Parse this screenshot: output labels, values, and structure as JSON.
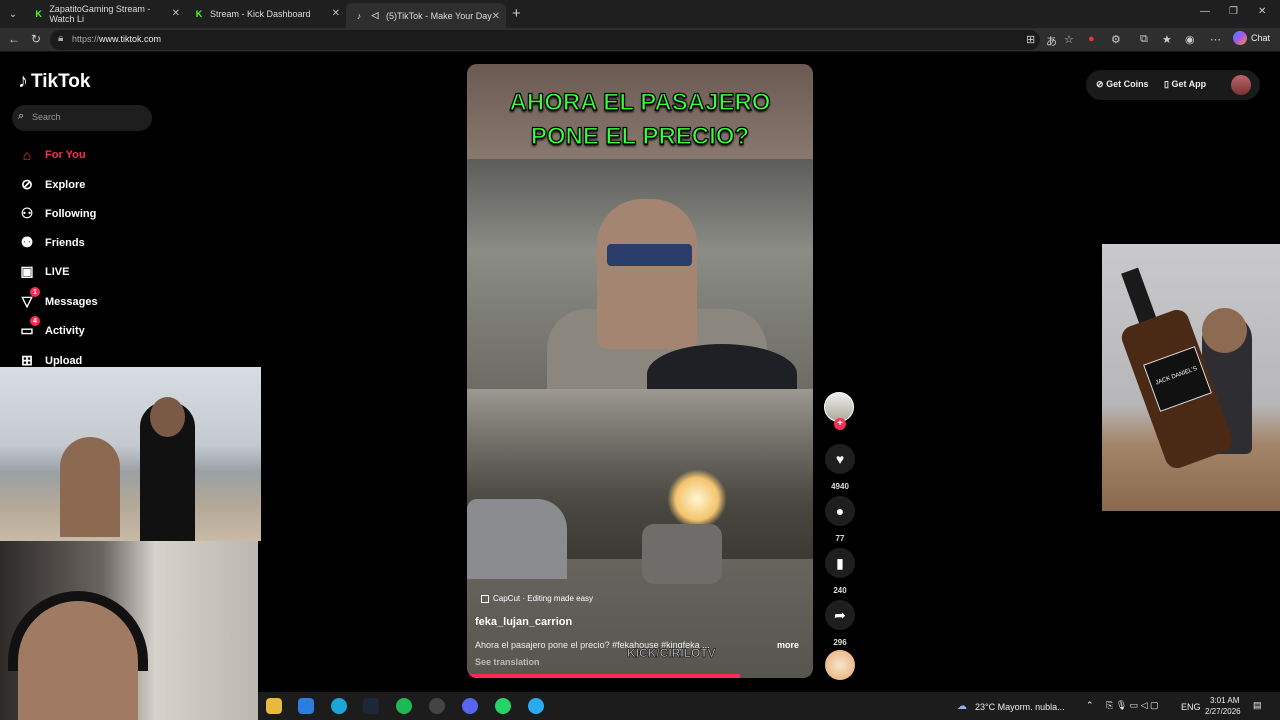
{
  "browser": {
    "tabs": [
      {
        "title": "ZapatitoGaming Stream - Watch Li"
      },
      {
        "title": "Stream - Kick Dashboard"
      },
      {
        "title": "(5)TikTok - Make Your Day",
        "active": true
      }
    ],
    "url_scheme": "https://",
    "url_host": "www.tiktok.com",
    "chat_label": "Chat"
  },
  "tiktok": {
    "logo": "TikTok",
    "search_placeholder": "Search",
    "nav": [
      {
        "label": "For You",
        "icon": "home-icon",
        "active": true
      },
      {
        "label": "Explore",
        "icon": "compass-icon"
      },
      {
        "label": "Following",
        "icon": "following-icon"
      },
      {
        "label": "Friends",
        "icon": "friends-icon"
      },
      {
        "label": "LIVE",
        "icon": "live-icon"
      },
      {
        "label": "Messages",
        "icon": "messages-icon",
        "badge": "1"
      },
      {
        "label": "Activity",
        "icon": "activity-icon",
        "badge": "4"
      },
      {
        "label": "Upload",
        "icon": "upload-icon"
      }
    ],
    "get_coins": "Get Coins",
    "get_app": "Get App",
    "accent": "#fe2c55"
  },
  "video": {
    "caption_line1": "AHORA EL PASAJERO",
    "caption_line2": "PONE EL PRECIO?",
    "capcut": "CapCut · Editing made easy",
    "author": "feka_lujan_carrion",
    "description": "Ahora el pasajero pone el precio? #fekahouse #kingfeka ...",
    "more": "more",
    "see_translation": "See translation",
    "watermark": "KICK/CIRILOTV",
    "likes": "4940",
    "comments": "77",
    "saves": "240",
    "shares": "296",
    "progress": 0.79
  },
  "overlay": {
    "bottle_label": "JACK DANIEL'S"
  },
  "taskbar": {
    "weather": "23°C  Mayorm. nubla...",
    "lang": "ENG",
    "time": "3:01 AM",
    "date": "2/27/2026"
  }
}
